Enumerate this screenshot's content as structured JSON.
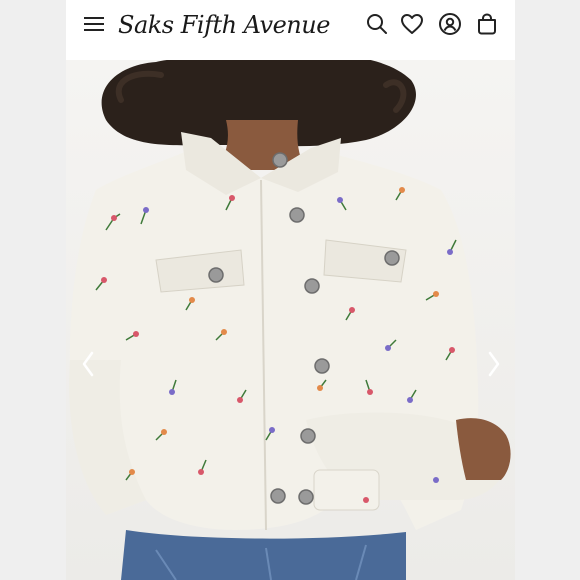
{
  "header": {
    "logo_text": "Saks Fifth Avenue",
    "icons": [
      "menu-icon",
      "search-icon",
      "heart-icon",
      "account-icon",
      "bag-icon"
    ]
  },
  "product_image": {
    "subject": "floral-print white denim jacket",
    "carousel_arrows": [
      "chevron-left-icon",
      "chevron-right-icon"
    ]
  },
  "colors": {
    "page_background": "#efefef",
    "header_background": "#ffffff",
    "icon_color": "#222222",
    "jacket_base": "#f3f1ea",
    "denim": "#4a6a98"
  }
}
